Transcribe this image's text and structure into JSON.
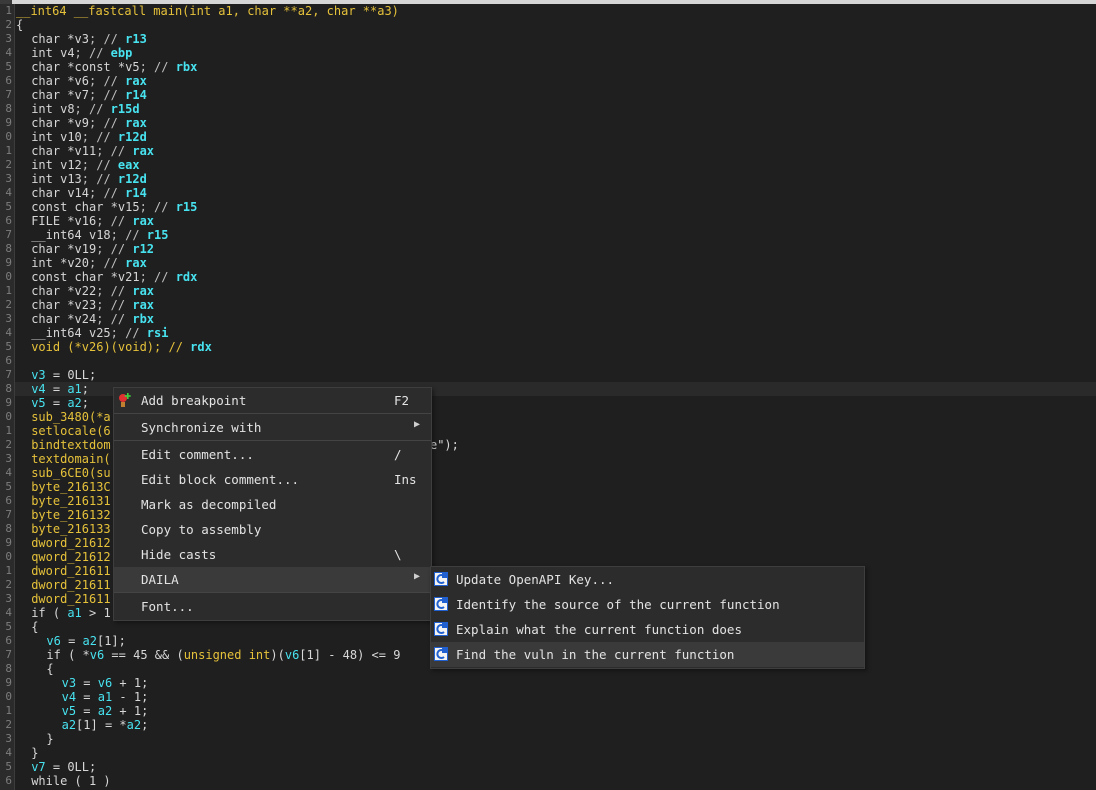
{
  "colors": {
    "background": "#1f1f1f",
    "keyword": "#e6c23a",
    "variable": "#48e3f0",
    "menu_background": "#2c2c2c",
    "menu_highlight": "#3a3a3a"
  },
  "code": {
    "line_numbers": [
      "1",
      "2",
      "3",
      "4",
      "5",
      "6",
      "7",
      "8",
      "9",
      "0",
      "1",
      "2",
      "3",
      "4",
      "5",
      "6",
      "7",
      "8",
      "9",
      "0",
      "1",
      "2",
      "3",
      "4",
      "5",
      "6",
      "7",
      "8",
      "9",
      "0",
      "1",
      "2",
      "3",
      "4",
      "5",
      "6",
      "7",
      "8",
      "9",
      "0",
      "1",
      "2",
      "3",
      "4",
      "5",
      "6",
      "7",
      "8",
      "9",
      "0",
      "1",
      "2",
      "3",
      "4",
      "5",
      "6"
    ],
    "signature": "__int64 __fastcall main(int a1, char **a2, char **a3)",
    "open_brace": "{",
    "decls": [
      {
        "type": "char *",
        "name": "v3",
        "reg": "r13"
      },
      {
        "type": "int ",
        "name": "v4",
        "reg": "ebp"
      },
      {
        "type": "char *const *",
        "name": "v5",
        "reg": "rbx"
      },
      {
        "type": "char *",
        "name": "v6",
        "reg": "rax"
      },
      {
        "type": "char *",
        "name": "v7",
        "reg": "r14"
      },
      {
        "type": "int ",
        "name": "v8",
        "reg": "r15d"
      },
      {
        "type": "char *",
        "name": "v9",
        "reg": "rax"
      },
      {
        "type": "int ",
        "name": "v10",
        "reg": "r12d"
      },
      {
        "type": "char *",
        "name": "v11",
        "reg": "rax"
      },
      {
        "type": "int ",
        "name": "v12",
        "reg": "eax"
      },
      {
        "type": "int ",
        "name": "v13",
        "reg": "r12d"
      },
      {
        "type": "char ",
        "name": "v14",
        "reg": "r14"
      },
      {
        "type": "const char *",
        "name": "v15",
        "reg": "r15"
      },
      {
        "type": "FILE *",
        "name": "v16",
        "reg": "rax"
      },
      {
        "type": "__int64 ",
        "name": "v18",
        "reg": "r15"
      },
      {
        "type": "char *",
        "name": "v19",
        "reg": "r12"
      },
      {
        "type": "int *",
        "name": "v20",
        "reg": "rax"
      },
      {
        "type": "const char *",
        "name": "v21",
        "reg": "rdx"
      },
      {
        "type": "char *",
        "name": "v22",
        "reg": "rax"
      },
      {
        "type": "char *",
        "name": "v23",
        "reg": "rax"
      },
      {
        "type": "char *",
        "name": "v24",
        "reg": "rbx"
      },
      {
        "type": "__int64 ",
        "name": "v25",
        "reg": "rsi"
      }
    ],
    "v26_decl": {
      "pre": "void (*",
      "name": "v26",
      "post": ")(void); // ",
      "reg": "rdx"
    },
    "body": {
      "l27": "v3 = 0LL;",
      "l28": "v4 = a1;",
      "l29": "v5 = a2;",
      "l30": "sub_3480(*a",
      "l31": "setlocale(6",
      "l32": "bindtextdom",
      "l32_tail": "e\");",
      "l33": "textdomain(",
      "l34": "sub_6CE0(su",
      "l35": "byte_21613C",
      "l36": "byte_216131",
      "l37": "byte_216132",
      "l38": "byte_216133",
      "l39": "dword_21612",
      "l40": "qword_21612",
      "l41": "dword_21611",
      "l42": "dword_21611",
      "l43": "dword_21611",
      "l44": "if ( a1 > 1",
      "l45": "{",
      "l46": "v6 = a2[1];",
      "l47": "if ( *v6 == 45 && (unsigned int)(v6[1] - 48) <= 9",
      "l48": "{",
      "l49": "v3 = v6 + 1;",
      "l50": "v4 = a1 - 1;",
      "l51": "v5 = a2 + 1;",
      "l52": "a2[1] = *a2;",
      "l53": "}",
      "l54": "}",
      "l55": "v7 = 0LL;",
      "l56": "while ( 1 )"
    }
  },
  "context_menu": {
    "items": [
      {
        "label": "Add breakpoint",
        "shortcut": "F2",
        "icon": "breakpoint-icon"
      },
      {
        "label": "Synchronize with",
        "shortcut": "",
        "submenu": true
      },
      {
        "label": "Edit comment...",
        "shortcut": "/"
      },
      {
        "label": "Edit block comment...",
        "shortcut": "Ins"
      },
      {
        "label": "Mark as decompiled",
        "shortcut": ""
      },
      {
        "label": "Copy to assembly",
        "shortcut": ""
      },
      {
        "label": "Hide casts",
        "shortcut": "\\"
      },
      {
        "label": "DAILA",
        "shortcut": "",
        "submenu": true
      },
      {
        "label": "Font...",
        "shortcut": ""
      }
    ]
  },
  "daila_submenu": {
    "items": [
      {
        "label": "Update OpenAPI Key...",
        "icon": "daila-plugin-icon"
      },
      {
        "label": "Identify the source of the current function",
        "icon": "daila-plugin-icon"
      },
      {
        "label": "Explain what the current function does",
        "icon": "daila-plugin-icon"
      },
      {
        "label": "Find the vuln in the current function",
        "icon": "daila-plugin-icon"
      }
    ]
  }
}
